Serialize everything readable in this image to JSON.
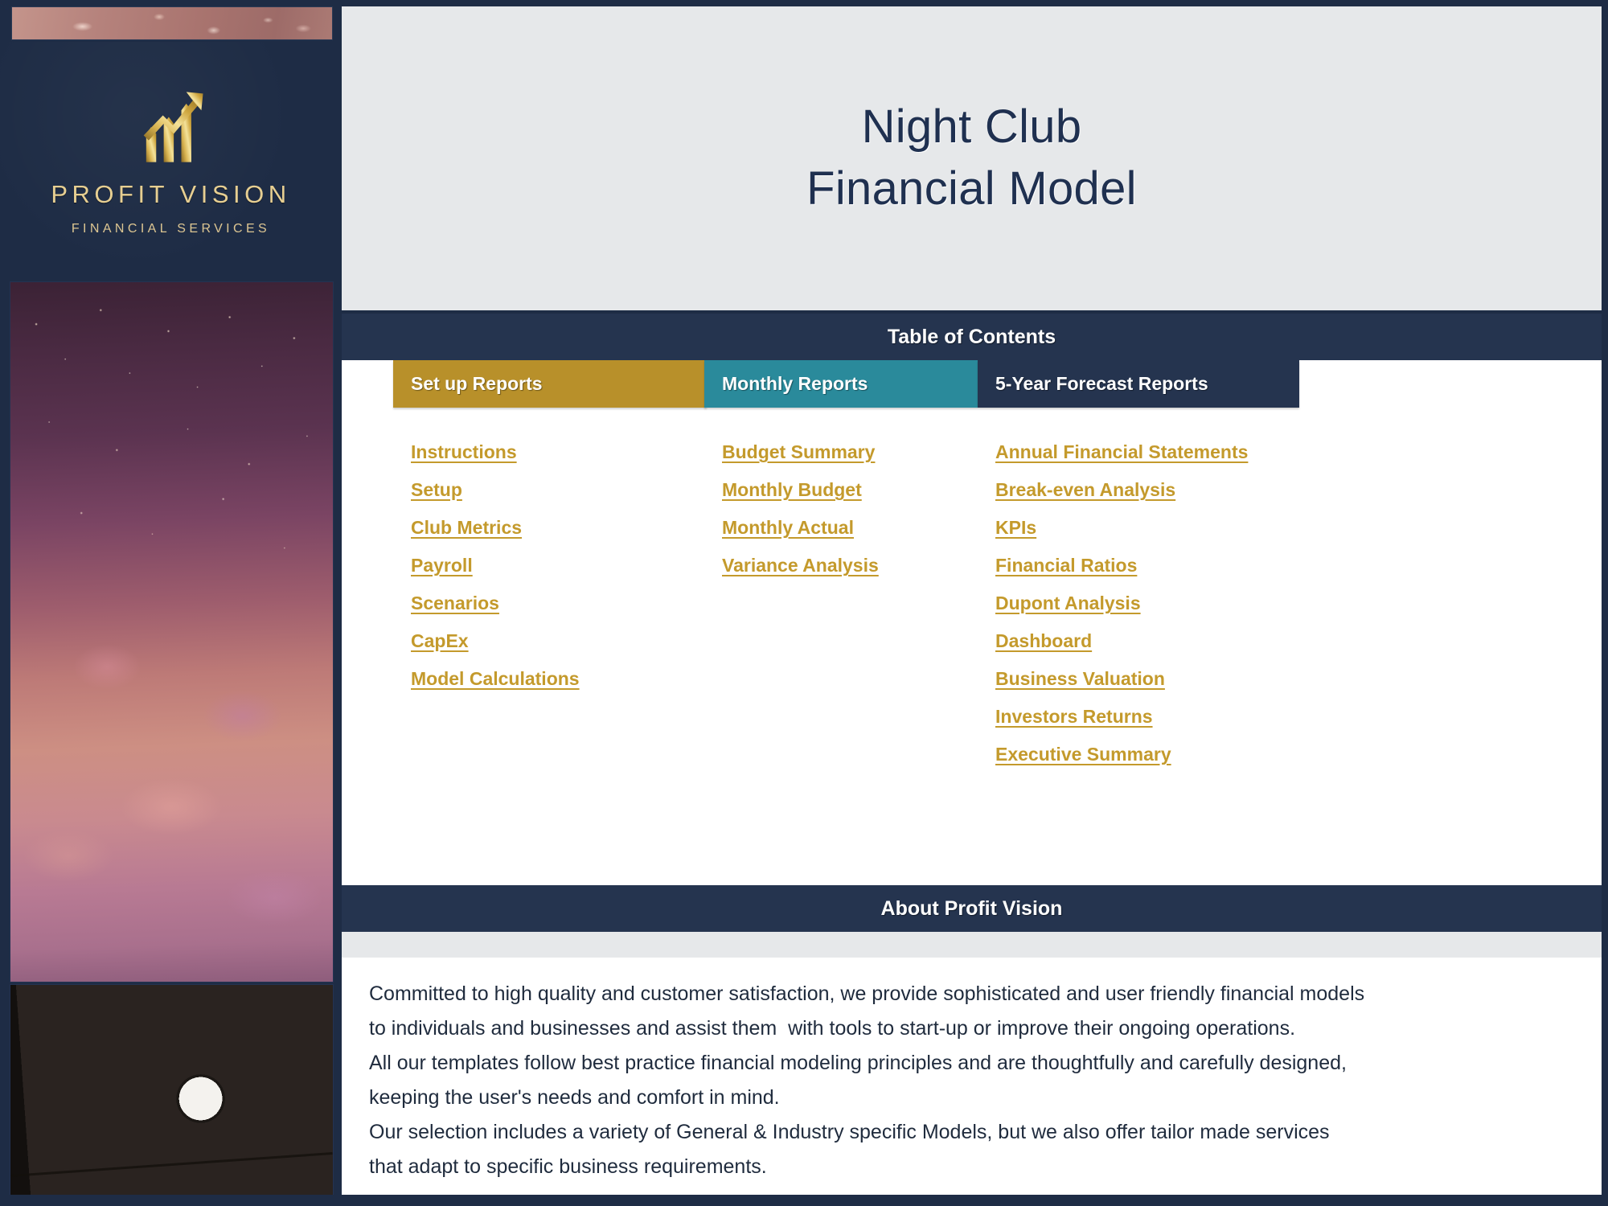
{
  "brand": {
    "name": "PROFIT VISION",
    "tagline": "FINANCIAL SERVICES",
    "logo_icon": "bar-chart-growth-arrow-icon",
    "navy": "#1e2c45",
    "gold": "#c49a2c",
    "teal": "#2a8a9b"
  },
  "header": {
    "title_line1": "Night Club",
    "title_line2": "Financial Model"
  },
  "toc": {
    "bar_label": "Table of Contents",
    "columns": [
      {
        "heading": "Set up Reports",
        "color": "#b8902a",
        "links": [
          "Instructions",
          "Setup",
          "Club Metrics",
          "Payroll",
          "Scenarios",
          "CapEx",
          "Model Calculations"
        ]
      },
      {
        "heading": "Monthly Reports",
        "color": "#2a8a9b",
        "links": [
          "Budget Summary",
          "Monthly Budget",
          "Monthly Actual",
          "Variance Analysis"
        ]
      },
      {
        "heading": "5-Year Forecast Reports",
        "color": "#25344f",
        "links": [
          "Annual Financial Statements",
          "Break-even Analysis",
          "KPIs",
          "Financial Ratios",
          "Dupont Analysis",
          "Dashboard",
          "Business Valuation",
          "Investors Returns",
          "Executive Summary"
        ]
      }
    ]
  },
  "about": {
    "bar_label": "About Profit Vision",
    "lines": [
      "Committed to high quality and customer satisfaction, we provide sophisticated and user friendly financial models",
      "to individuals and businesses and assist them  with tools to start-up or improve their ongoing operations.",
      "All our templates follow best practice financial modeling principles and are thoughtfully and carefully designed,",
      "keeping the user's needs and comfort in mind.",
      "Our selection includes a variety of General & Industry specific Models, but we also offer tailor made services",
      "that adapt to specific business requirements."
    ]
  },
  "sidebar_images": {
    "top_strip": "abstract-texture-strip",
    "crowd_photo": "night-club-crowd-photo",
    "dj_photo": "dj-turntable-deck-photo"
  }
}
